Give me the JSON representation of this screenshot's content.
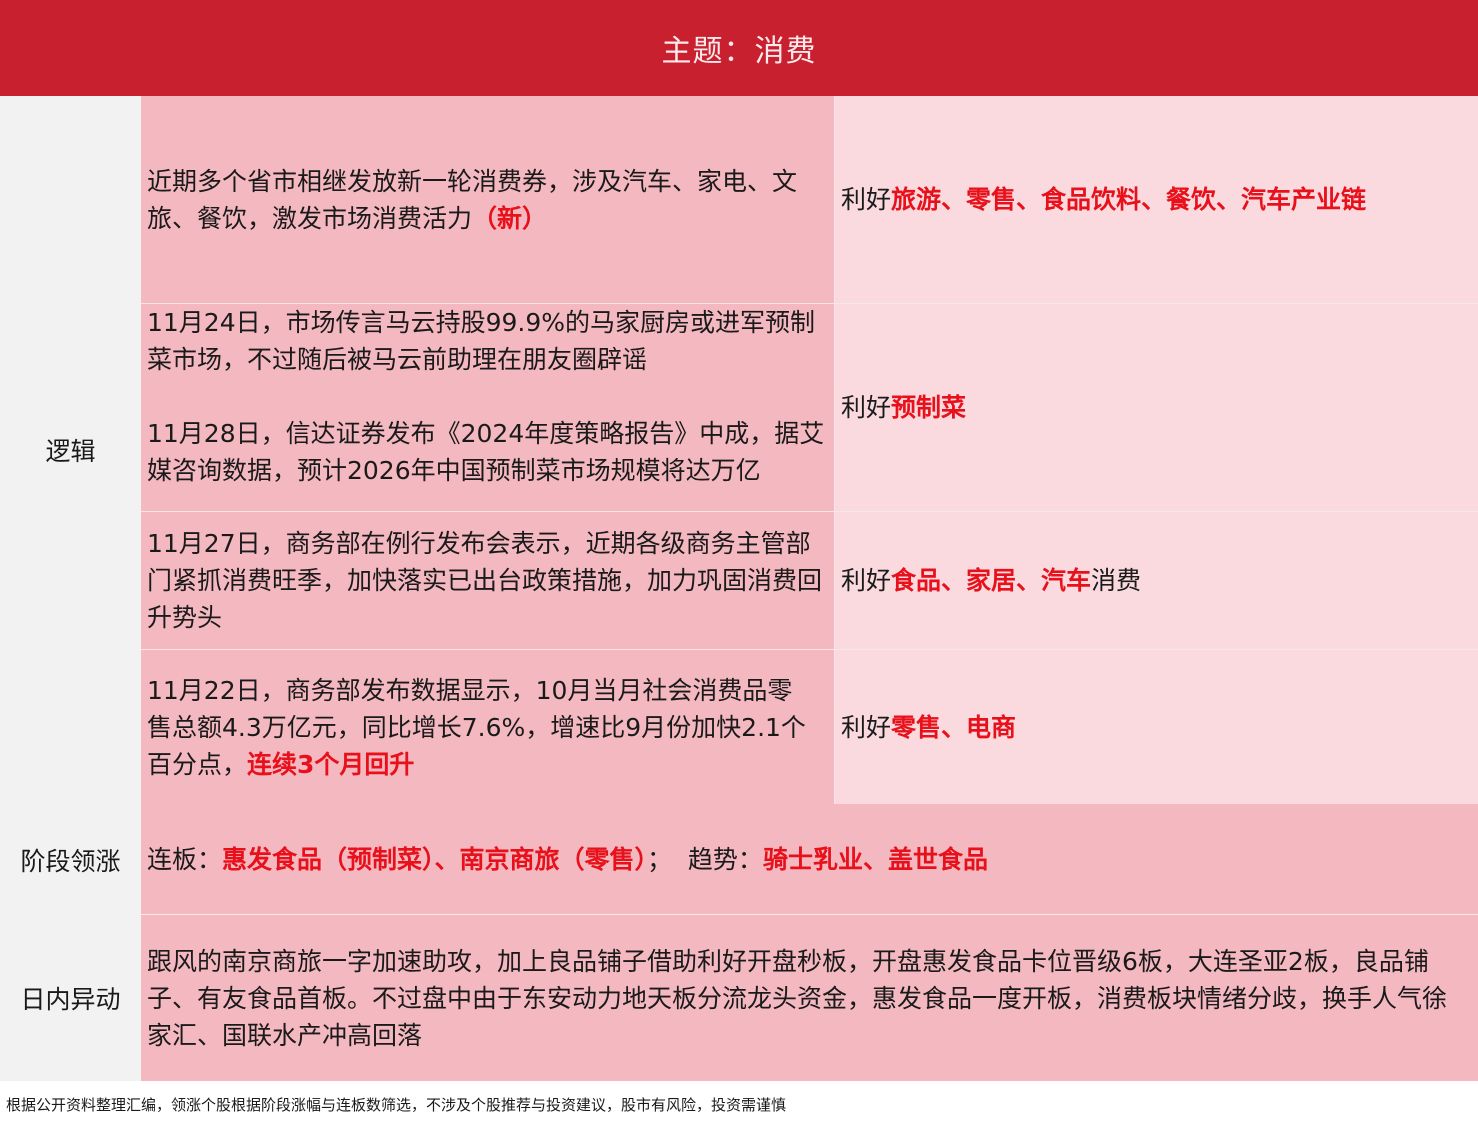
{
  "header": {
    "title": "主题：消费"
  },
  "labels": {
    "logic": "逻辑",
    "stage_lead": "阶段领涨",
    "intraday": "日内异动"
  },
  "rows": [
    {
      "left": {
        "text": "近期多个省市相继发放新一轮消费券，涉及汽车、家电、文旅、餐饮，激发市场消费活力",
        "highlight": "（新）"
      },
      "right": {
        "prefix": "利好",
        "highlight": "旅游、零售、食品饮料、餐饮、汽车产业链"
      }
    },
    {
      "left": {
        "para1": "11月24日，市场传言马云持股99.9%的马家厨房或进军预制菜市场，不过随后被马云前助理在朋友圈辟谣",
        "para2": "11月28日，信达证券发布《2024年度策略报告》中成，据艾媒咨询数据，预计2026年中国预制菜市场规模将达万亿"
      },
      "right": {
        "prefix": "利好",
        "highlight": "预制菜"
      }
    },
    {
      "left": {
        "text": "11月27日，商务部在例行发布会表示，近期各级商务主管部门紧抓消费旺季，加快落实已出台政策措施，加力巩固消费回升势头"
      },
      "right": {
        "prefix": "利好",
        "highlight": "食品、家居、汽车",
        "suffix": "消费"
      }
    },
    {
      "left": {
        "text": "11月22日，商务部发布数据显示，10月当月社会消费品零售总额4.3万亿元，同比增长7.6%，增速比9月份加快2.1个百分点，",
        "highlight": "连续3个月回升"
      },
      "right": {
        "prefix": "利好",
        "highlight": "零售、电商"
      }
    }
  ],
  "stage": {
    "prefix1": "连板：",
    "highlight1": "惠发食品（预制菜）、南京商旅（零售）",
    "sep": "；  趋势：",
    "highlight2": "骑士乳业、盖世食品"
  },
  "intraday": {
    "text": "跟风的南京商旅一字加速助攻，加上良品铺子借助利好开盘秒板，开盘惠发食品卡位晋级6板，大连圣亚2板，良品铺子、有友食品首板。不过盘中由于东安动力地天板分流龙头资金，惠发食品一度开板，消费板块情绪分歧，换手人气徐家汇、国联水产冲高回落"
  },
  "footer": {
    "text": "根据公开资料整理汇编，领涨个股根据阶段涨幅与连板数筛选，不涉及个股推荐与投资建议，股市有风险，投资需谨慎"
  },
  "colors": {
    "header_bg": "#c8202f",
    "highlight": "#e8101a",
    "cell_dark": "#f4b8c0",
    "cell_light": "#fadadf",
    "label_bg": "#f2f2f2"
  }
}
